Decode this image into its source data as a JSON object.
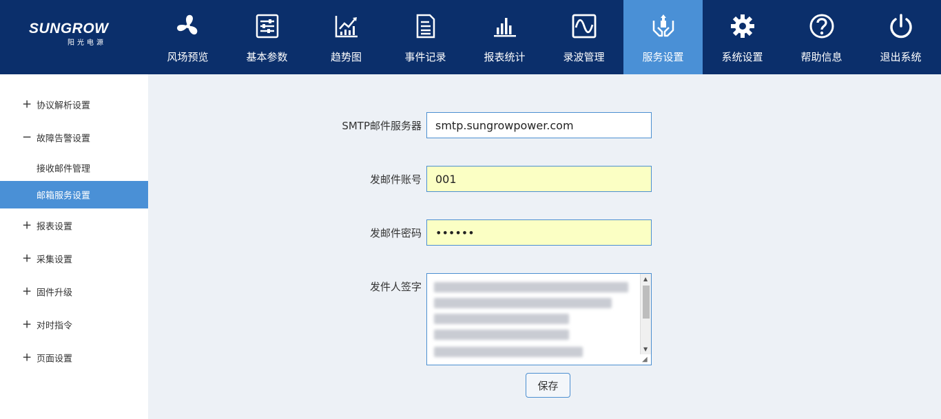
{
  "logo": {
    "word": "SUNGROW",
    "sub": "阳光电源"
  },
  "nav": [
    {
      "label": "风场预览",
      "icon": "fan-icon"
    },
    {
      "label": "基本参数",
      "icon": "sliders-icon"
    },
    {
      "label": "趋势图",
      "icon": "trend-chart-icon"
    },
    {
      "label": "事件记录",
      "icon": "document-icon"
    },
    {
      "label": "报表统计",
      "icon": "bar-chart-icon"
    },
    {
      "label": "录波管理",
      "icon": "waveform-icon"
    },
    {
      "label": "服务设置",
      "icon": "service-hands-icon",
      "active": true
    },
    {
      "label": "系统设置",
      "icon": "gear-icon"
    },
    {
      "label": "帮助信息",
      "icon": "help-icon"
    },
    {
      "label": "退出系统",
      "icon": "power-icon"
    }
  ],
  "sidebar": {
    "items": [
      {
        "sign": "+",
        "label": "协议解析设置"
      },
      {
        "sign": "−",
        "label": "故障告警设置"
      },
      {
        "sign": "",
        "label": "接收邮件管理"
      },
      {
        "sign": "",
        "label": "邮箱服务设置",
        "active": true
      },
      {
        "sign": "+",
        "label": "报表设置"
      },
      {
        "sign": "+",
        "label": "采集设置"
      },
      {
        "sign": "+",
        "label": "固件升级"
      },
      {
        "sign": "+",
        "label": "对时指令"
      },
      {
        "sign": "+",
        "label": "页面设置"
      }
    ]
  },
  "form": {
    "smtp_label": "SMTP邮件服务器",
    "smtp_value": "smtp.sungrowpower.com",
    "account_label": "发邮件账号",
    "account_value": "001",
    "password_label": "发邮件密码",
    "password_value": "••••••",
    "signature_label": "发件人签字",
    "save_label": "保存"
  },
  "colors": {
    "topbar": "#0b2f6b",
    "active": "#4a90d6",
    "background": "#edf1f6",
    "autofill": "#fbffc4"
  }
}
